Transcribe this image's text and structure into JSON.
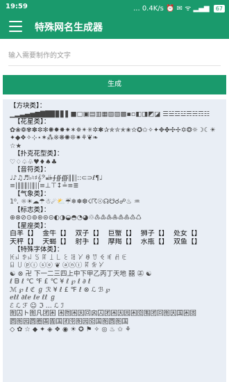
{
  "status": {
    "time": "19:59",
    "right": "... 0.4K/s ⏰ ✉ ᯤ ▂▄▆",
    "battery": "67"
  },
  "app": {
    "title": "特殊网名生成器"
  },
  "input": {
    "placeholder": "输入需要制作的文字"
  },
  "button": {
    "label": "生成"
  },
  "sections": {
    "fangkuai_title": "【方块类】：",
    "fangkuai_syms": "▁▂▃▄▅▆▇█▉▊▋▌■□▣▤▥▦▧▨▩▪▫◧◨◩◪ ☰☱☲☳☴☵☶☷",
    "huaxing_title": "【花星类】：",
    "huaxing_syms1": "✿❀❁✾✽✼✻✺✹✸✷✶✵✴✳✲✱✰✯✮✭✬✫✪✩✧✦✥✤✣✢✡❂☼☽☾☀",
    "huaxing_syms2": "✦◆❖✧⊹⋆✶⁂※❋✺❊✷⚘❦❧",
    "huaxing_syms3": "☆★",
    "puke_title": "【扑克花型类】：",
    "puke_syms": "♡♢♤♧♥♦♠♣",
    "yinfu_title": "【音符类】：",
    "yinfu_syms1": "♩♪♫♬♭♮♯𝄞𝄢𝄪𝄫∮∯∰‖‖|::⊂⊃ℓ¶♩",
    "yinfu_syms2": "≡|‖‖‖||‖||≡⊥⊤↕≟≡≣",
    "qixiang_title": "【气象类】：",
    "qixiang_syms": "1⁰. ☼☀☁☂☃☄⛅☔❄❅❆☇☈☉☊☋☌☍♨ ♒",
    "biaozhi_title": "【标志类】：",
    "biaozhi_syms": "⊕⊗⊘⊙⊚⊛⊜⊝◐◑◒◓◔◕♲♳♴♵♶♷♸♹♺",
    "xingzuo_title": "【星座类】：",
    "zodiac_row1": [
      "白羊【】",
      "金牛【】",
      "双子【】",
      "巨蟹【】",
      "狮子【】",
      "处女【】"
    ],
    "zodiac_row2": [
      "天秤【】",
      "天蝎【】",
      "射手【】",
      "摩羯【】",
      "水瓶【】",
      "双鱼【】"
    ],
    "teshu_title": "【特殊字体类】：",
    "teshu_line1": "ꀘꈤ ꉣꈤ ꌗ ꍏ ꀤ ꒒ ꏂ ꌃ ꐓ ꊿ ꀎ ꈼ ꎭ ꋬ ꍟ",
    "teshu_line2": "ꆰ ꒤ ⓟⓘ ⓢⓔ ❦ ⓐⓝⓘ  ꍏ ꆗ ꐓ ",
    "teshu_line3": "☯ ⊗ 卍 下一二三四上中下甲乙丙丁天地 囍 ㊣ ☯",
    "teshu_line4": "ℓ ᗷ  ℓ ℃ ℉ £  ℃ ¥ ℓ ℘ ℓ ∂ ℓ",
    "teshu_line5": "ℳ ℘ ℓ ℭ ℊ ℛ ¥ ℓ £ ℉ ℓ ⊗ ℒ ℬ ℘",
    "teshu_line6": "ℯℓℓ ∂ℓℯ ℓℯ ℓℓ ℊ",
    "teshu_line7": "ℰ ℒ ℱ ☺ ℑ ... ℒ ℐ",
    "teshu_line8": "图囚ト图凡团困 困囫困因回囟囚团困因园困囵围团回图因国困固",
    "teshu_line9": "圆图园圆圈圄圊国团囹图园囵国图圆图国",
    "teshu_line10": "◇ ✿ ☆ ◆ ✦ ◈ ❖ ◉ ☀ ✪ ⚑ ✧ ◎ ♨ ✩ ⚘"
  }
}
